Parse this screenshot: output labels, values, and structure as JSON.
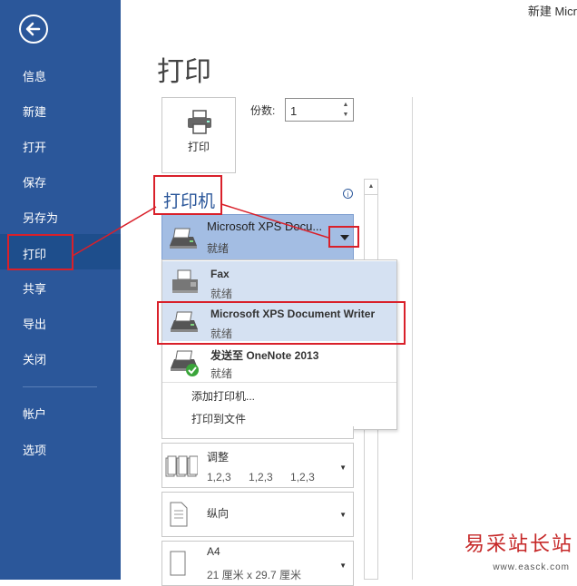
{
  "window": {
    "title": "新建 Micr"
  },
  "sidebar": {
    "back_icon": "back-arrow-icon",
    "items": [
      {
        "label": "信息"
      },
      {
        "label": "新建"
      },
      {
        "label": "打开"
      },
      {
        "label": "保存"
      },
      {
        "label": "另存为"
      },
      {
        "label": "打印",
        "selected": true
      },
      {
        "label": "共享"
      },
      {
        "label": "导出"
      },
      {
        "label": "关闭"
      },
      {
        "label": "帐户"
      },
      {
        "label": "选项"
      }
    ]
  },
  "main": {
    "title": "打印",
    "print_button_label": "打印",
    "copies_label": "份数:",
    "copies_value": "1",
    "printer_heading": "打印机",
    "selected_printer": {
      "name": "Microsoft XPS Docu...",
      "status": "就绪"
    },
    "printer_options": [
      {
        "name": "Fax",
        "status": "就绪"
      },
      {
        "name": "Microsoft XPS Document Writer",
        "status": "就绪"
      },
      {
        "name": "发送至 OneNote 2013",
        "status": "就绪"
      }
    ],
    "add_printer": "添加打印机...",
    "print_to_file": "打印到文件",
    "settings": {
      "collate": {
        "name": "调整",
        "detail": "1,2,3 1,2,3 1,2,3"
      },
      "orientation": {
        "name": "纵向"
      },
      "paper": {
        "name": "A4",
        "detail": "21 厘米 x 29.7 厘米"
      }
    }
  },
  "watermark": {
    "text": "易采站长站",
    "url": "www.easck.com"
  },
  "colors": {
    "sidebar": "#2b579a",
    "selected_printer": "#a3bde3",
    "highlight_box": "#d9202a"
  }
}
